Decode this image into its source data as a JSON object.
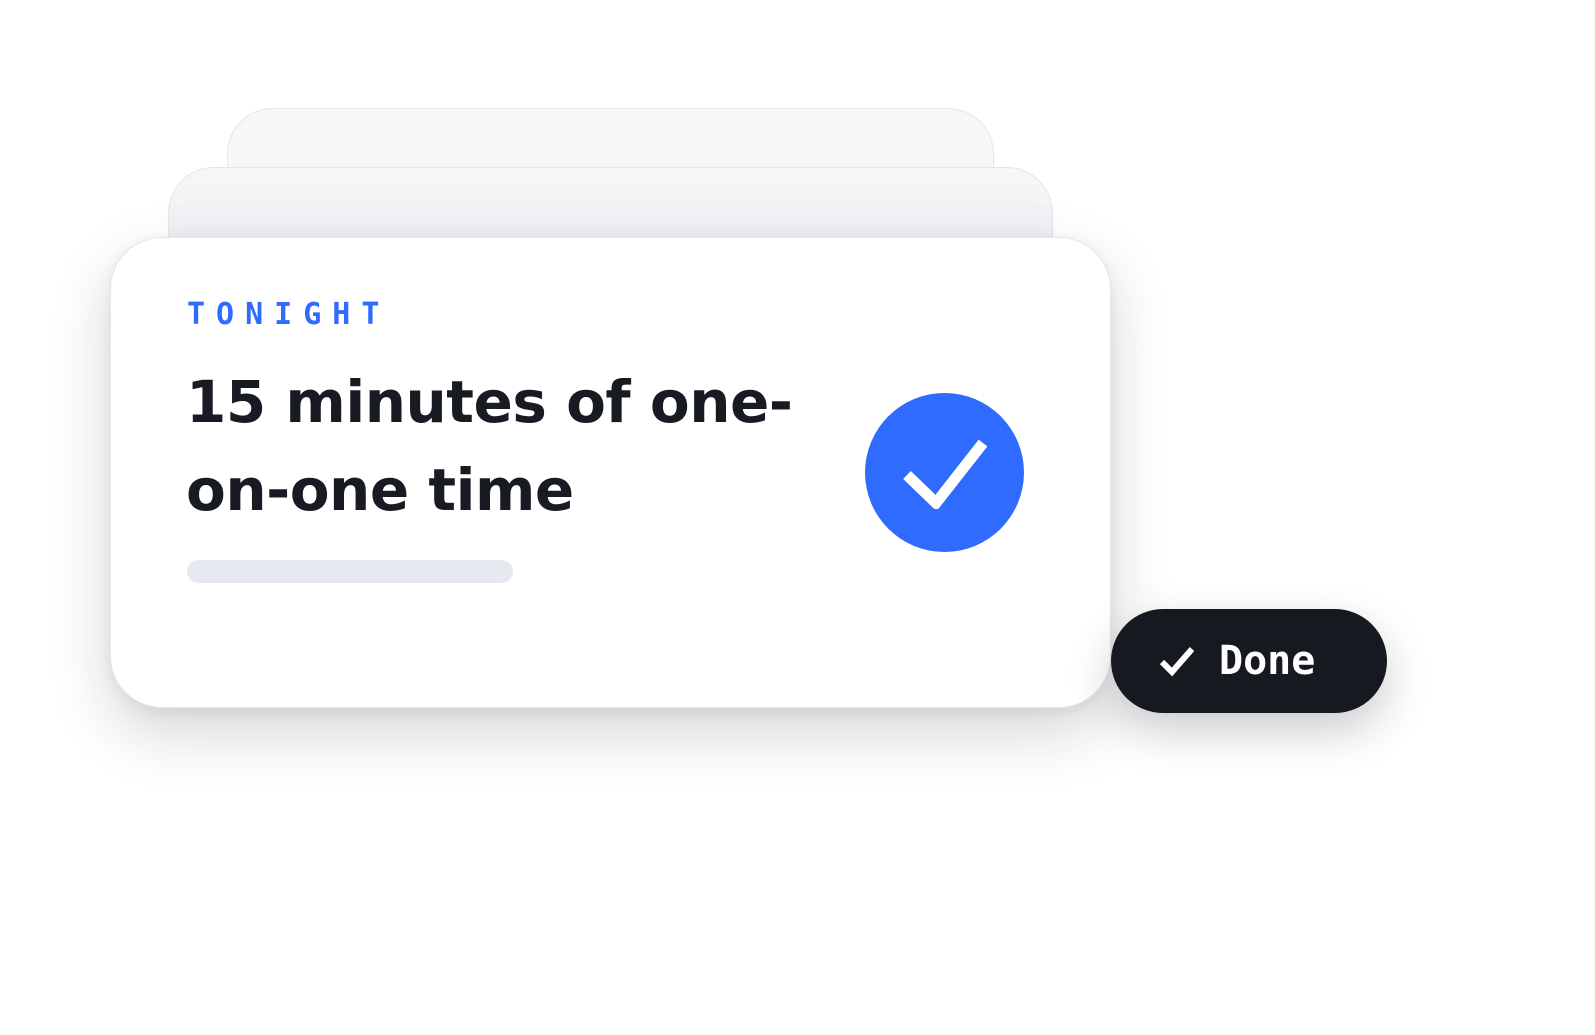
{
  "card": {
    "eyebrow": "TONIGHT",
    "title": "15 minutes of one-on-one time",
    "progress": 0,
    "check_icon": "check-circle-icon"
  },
  "done_button": {
    "label": "Done",
    "icon": "check-icon"
  },
  "colors": {
    "accent": "#2f6bff",
    "dark": "#161920",
    "text": "#181b22",
    "track": "#e6e9ef"
  }
}
